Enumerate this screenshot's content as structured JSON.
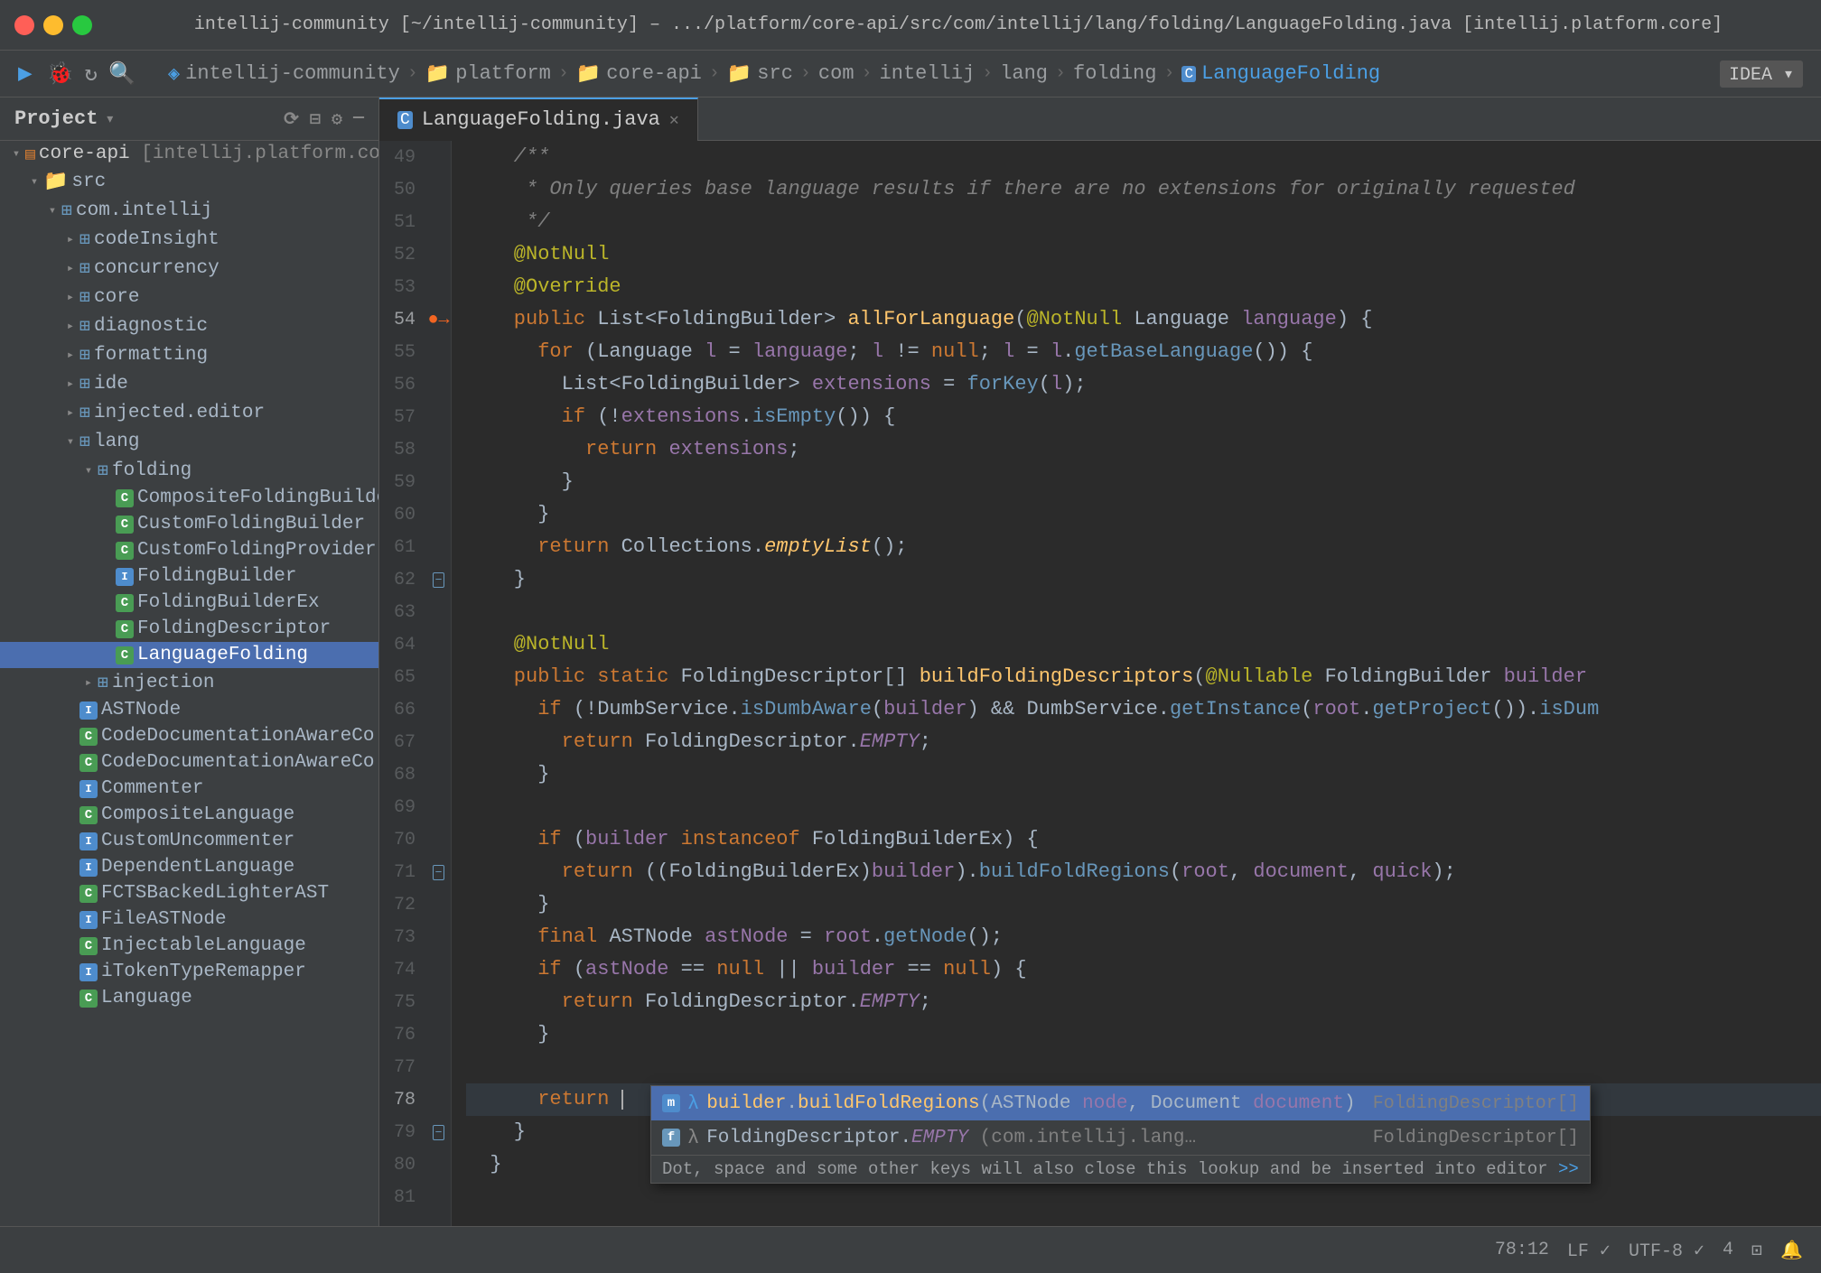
{
  "window": {
    "title": "intellij-community [~/intellij-community] – .../platform/core-api/src/com/intellij/lang/folding/LanguageFolding.java [intellij.platform.core]"
  },
  "breadcrumbs": [
    {
      "label": "intellij-community",
      "type": "project"
    },
    {
      "label": "platform",
      "type": "folder"
    },
    {
      "label": "core-api",
      "type": "folder"
    },
    {
      "label": "src",
      "type": "folder"
    },
    {
      "label": "com",
      "type": "folder"
    },
    {
      "label": "intellij",
      "type": "package"
    },
    {
      "label": "lang",
      "type": "package"
    },
    {
      "label": "folding",
      "type": "package"
    },
    {
      "label": "LanguageFolding",
      "type": "class"
    }
  ],
  "sidebar": {
    "title": "Project",
    "items": [
      {
        "level": 0,
        "label": "core-api [intellij.platform.core]",
        "type": "module",
        "expanded": true
      },
      {
        "level": 1,
        "label": "src",
        "type": "folder",
        "expanded": true
      },
      {
        "level": 2,
        "label": "com.intellij",
        "type": "package",
        "expanded": true
      },
      {
        "level": 3,
        "label": "codeInsight",
        "type": "package",
        "expanded": false
      },
      {
        "level": 3,
        "label": "concurrency",
        "type": "package",
        "expanded": false
      },
      {
        "level": 3,
        "label": "core",
        "type": "package",
        "expanded": false
      },
      {
        "level": 3,
        "label": "diagnostic",
        "type": "package",
        "expanded": false
      },
      {
        "level": 3,
        "label": "formatting",
        "type": "package",
        "expanded": false
      },
      {
        "level": 3,
        "label": "ide",
        "type": "package",
        "expanded": false
      },
      {
        "level": 3,
        "label": "injected.editor",
        "type": "package",
        "expanded": false
      },
      {
        "level": 3,
        "label": "lang",
        "type": "package",
        "expanded": true
      },
      {
        "level": 4,
        "label": "folding",
        "type": "package",
        "expanded": true
      },
      {
        "level": 5,
        "label": "CompositeFoldingBuilder",
        "type": "class-c"
      },
      {
        "level": 5,
        "label": "CustomFoldingBuilder",
        "type": "class-c"
      },
      {
        "level": 5,
        "label": "CustomFoldingProvider",
        "type": "class-c"
      },
      {
        "level": 5,
        "label": "FoldingBuilder",
        "type": "interface-i"
      },
      {
        "level": 5,
        "label": "FoldingBuilderEx",
        "type": "class-c"
      },
      {
        "level": 5,
        "label": "FoldingDescriptor",
        "type": "class-c"
      },
      {
        "level": 5,
        "label": "LanguageFolding",
        "type": "class-c",
        "selected": true
      },
      {
        "level": 4,
        "label": "injection",
        "type": "package",
        "expanded": false
      },
      {
        "level": 3,
        "label": "ASTNode",
        "type": "interface-i"
      },
      {
        "level": 3,
        "label": "CodeDocumentationAwareCo",
        "type": "class-c"
      },
      {
        "level": 3,
        "label": "CodeDocumentationAwareCo",
        "type": "class-c"
      },
      {
        "level": 3,
        "label": "Commenter",
        "type": "interface-i"
      },
      {
        "level": 3,
        "label": "CompositeLanguage",
        "type": "class-c"
      },
      {
        "level": 3,
        "label": "CustomUncommenter",
        "type": "interface-i"
      },
      {
        "level": 3,
        "label": "DependentLanguage",
        "type": "interface-i"
      },
      {
        "level": 3,
        "label": "FCTSBackedLighterAST",
        "type": "class-c"
      },
      {
        "level": 3,
        "label": "FileASTNode",
        "type": "interface-i"
      },
      {
        "level": 3,
        "label": "InjectableLanguage",
        "type": "class-c"
      },
      {
        "level": 3,
        "label": "iTokenTypeRemapper",
        "type": "interface-i"
      },
      {
        "level": 3,
        "label": "Language",
        "type": "class-c"
      }
    ]
  },
  "tab": {
    "label": "LanguageFolding.java",
    "active": true
  },
  "code": {
    "lines": [
      {
        "num": 49,
        "content": "    /**",
        "type": "comment"
      },
      {
        "num": 50,
        "content": "     * Only queries base language results if there are no extensions for originally requested",
        "type": "comment"
      },
      {
        "num": 51,
        "content": "     */",
        "type": "comment"
      },
      {
        "num": 52,
        "content": "    @NotNull",
        "type": "annotation"
      },
      {
        "num": 53,
        "content": "    @Override",
        "type": "annotation"
      },
      {
        "num": 54,
        "content": "    public List<FoldingBuilder> allForLanguage(@NotNull Language language) {",
        "type": "code"
      },
      {
        "num": 55,
        "content": "      for (Language l = language; l != null; l = l.getBaseLanguage()) {",
        "type": "code"
      },
      {
        "num": 56,
        "content": "        List<FoldingBuilder> extensions = forKey(l);",
        "type": "code"
      },
      {
        "num": 57,
        "content": "        if (!extensions.isEmpty()) {",
        "type": "code"
      },
      {
        "num": 58,
        "content": "          return extensions;",
        "type": "code"
      },
      {
        "num": 59,
        "content": "        }",
        "type": "code"
      },
      {
        "num": 60,
        "content": "      }",
        "type": "code"
      },
      {
        "num": 61,
        "content": "      return Collections.emptyList();",
        "type": "code"
      },
      {
        "num": 62,
        "content": "    }",
        "type": "code"
      },
      {
        "num": 63,
        "content": "",
        "type": "blank"
      },
      {
        "num": 64,
        "content": "    @NotNull",
        "type": "annotation"
      },
      {
        "num": 65,
        "content": "    public static FoldingDescriptor[] buildFoldingDescriptors(@Nullable FoldingBuilder builder",
        "type": "code"
      },
      {
        "num": 66,
        "content": "      if (!DumbService.isDumbAware(builder) && DumbService.getInstance(root.getProject()).isDum",
        "type": "code"
      },
      {
        "num": 67,
        "content": "        return FoldingDescriptor.EMPTY;",
        "type": "code"
      },
      {
        "num": 68,
        "content": "      }",
        "type": "code"
      },
      {
        "num": 69,
        "content": "",
        "type": "blank"
      },
      {
        "num": 70,
        "content": "      if (builder instanceof FoldingBuilderEx) {",
        "type": "code"
      },
      {
        "num": 71,
        "content": "        return ((FoldingBuilderEx)builder).buildFoldRegions(root, document, quick);",
        "type": "code"
      },
      {
        "num": 72,
        "content": "      }",
        "type": "code"
      },
      {
        "num": 73,
        "content": "      final ASTNode astNode = root.getNode();",
        "type": "code"
      },
      {
        "num": 74,
        "content": "      if (astNode == null || builder == null) {",
        "type": "code"
      },
      {
        "num": 75,
        "content": "        return FoldingDescriptor.EMPTY;",
        "type": "code"
      },
      {
        "num": 76,
        "content": "      }",
        "type": "code"
      },
      {
        "num": 77,
        "content": "",
        "type": "blank"
      },
      {
        "num": 78,
        "content": "      return ",
        "type": "code-cursor"
      },
      {
        "num": 79,
        "content": "    }",
        "type": "code"
      },
      {
        "num": 80,
        "content": "  }",
        "type": "code"
      },
      {
        "num": 81,
        "content": "",
        "type": "blank"
      }
    ]
  },
  "autocomplete": {
    "items": [
      {
        "icon": "method",
        "label": "builder.buildFoldRegions(ASTNode node, Document document)",
        "type": "FoldingDescriptor[]",
        "selected": true
      },
      {
        "icon": "field",
        "label": "FoldingDescriptor.EMPTY  (com.intellij.lang…",
        "type": "FoldingDescriptor[]",
        "selected": false
      }
    ],
    "hint": "Dot, space and some other keys will also close this lookup and be inserted into editor",
    "hint_link": ">>"
  },
  "status_bar": {
    "position": "78:12",
    "line_separator": "LF ✓",
    "encoding": "UTF-8 ✓",
    "indent": "4",
    "items": []
  }
}
